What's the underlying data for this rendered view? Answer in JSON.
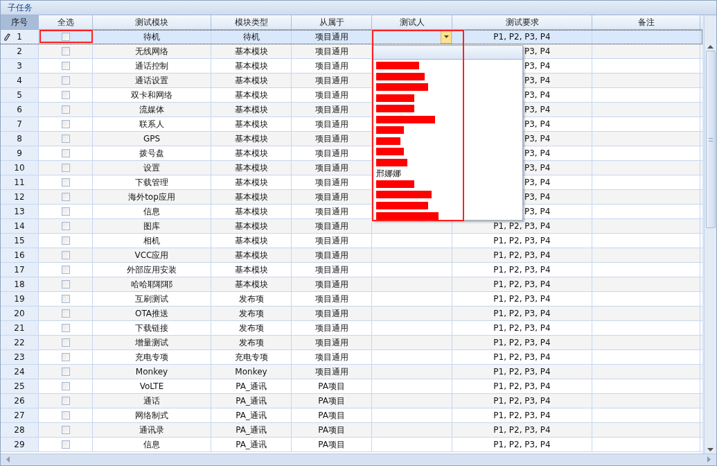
{
  "panel": {
    "title": "子任务"
  },
  "table": {
    "columns": [
      "序号",
      "全选",
      "测试模块",
      "模块类型",
      "从属于",
      "测试人",
      "测试要求",
      "备注"
    ],
    "rows": [
      {
        "num": "1",
        "checked": false,
        "selected": true,
        "module": "待机",
        "type": "待机",
        "belongs": "项目通用",
        "requirement": "P1, P2, P3, P4",
        "requirement_clipped": false
      },
      {
        "num": "2",
        "checked": false,
        "selected": false,
        "module": "无线网络",
        "type": "基本模块",
        "belongs": "项目通用",
        "requirement": "P3, P4",
        "requirement_clipped": true
      },
      {
        "num": "3",
        "checked": false,
        "selected": false,
        "module": "通话控制",
        "type": "基本模块",
        "belongs": "项目通用",
        "requirement": "P3, P4",
        "requirement_clipped": true
      },
      {
        "num": "4",
        "checked": false,
        "selected": false,
        "module": "通话设置",
        "type": "基本模块",
        "belongs": "项目通用",
        "requirement": "P3, P4",
        "requirement_clipped": true
      },
      {
        "num": "5",
        "checked": false,
        "selected": false,
        "module": "双卡和网络",
        "type": "基本模块",
        "belongs": "项目通用",
        "requirement": "P3, P4",
        "requirement_clipped": true
      },
      {
        "num": "6",
        "checked": false,
        "selected": false,
        "module": "流媒体",
        "type": "基本模块",
        "belongs": "项目通用",
        "requirement": "P3, P4",
        "requirement_clipped": true
      },
      {
        "num": "7",
        "checked": false,
        "selected": false,
        "module": "联系人",
        "type": "基本模块",
        "belongs": "项目通用",
        "requirement": "P3, P4",
        "requirement_clipped": true
      },
      {
        "num": "8",
        "checked": false,
        "selected": false,
        "module": "GPS",
        "type": "基本模块",
        "belongs": "项目通用",
        "requirement": "P3, P4",
        "requirement_clipped": true
      },
      {
        "num": "9",
        "checked": false,
        "selected": false,
        "module": "拨号盘",
        "type": "基本模块",
        "belongs": "项目通用",
        "requirement": "P3, P4",
        "requirement_clipped": true
      },
      {
        "num": "10",
        "checked": false,
        "selected": false,
        "module": "设置",
        "type": "基本模块",
        "belongs": "项目通用",
        "requirement": "P3, P4",
        "requirement_clipped": true
      },
      {
        "num": "11",
        "checked": false,
        "selected": false,
        "module": "下载管理",
        "type": "基本模块",
        "belongs": "项目通用",
        "requirement": "P3, P4",
        "requirement_clipped": true
      },
      {
        "num": "12",
        "checked": false,
        "selected": false,
        "module": "海外top应用",
        "type": "基本模块",
        "belongs": "项目通用",
        "requirement": "P3, P4",
        "requirement_clipped": true
      },
      {
        "num": "13",
        "checked": false,
        "selected": false,
        "module": "信息",
        "type": "基本模块",
        "belongs": "项目通用",
        "requirement": "P3, P4",
        "requirement_clipped": true
      },
      {
        "num": "14",
        "checked": false,
        "selected": false,
        "module": "图库",
        "type": "基本模块",
        "belongs": "项目通用",
        "requirement": "P1, P2, P3, P4",
        "requirement_clipped": false
      },
      {
        "num": "15",
        "checked": false,
        "selected": false,
        "module": "相机",
        "type": "基本模块",
        "belongs": "项目通用",
        "requirement": "P1, P2, P3, P4",
        "requirement_clipped": false
      },
      {
        "num": "16",
        "checked": false,
        "selected": false,
        "module": "VCC应用",
        "type": "基本模块",
        "belongs": "项目通用",
        "requirement": "P1, P2, P3, P4",
        "requirement_clipped": false
      },
      {
        "num": "17",
        "checked": false,
        "selected": false,
        "module": "外部应用安装",
        "type": "基本模块",
        "belongs": "项目通用",
        "requirement": "P1, P2, P3, P4",
        "requirement_clipped": false
      },
      {
        "num": "18",
        "checked": false,
        "selected": false,
        "module": "哈哈耶耶耶",
        "type": "基本模块",
        "belongs": "项目通用",
        "requirement": "P1, P2, P3, P4",
        "requirement_clipped": false
      },
      {
        "num": "19",
        "checked": false,
        "selected": false,
        "module": "互刷测试",
        "type": "发布项",
        "belongs": "项目通用",
        "requirement": "P1, P2, P3, P4",
        "requirement_clipped": false
      },
      {
        "num": "20",
        "checked": false,
        "selected": false,
        "module": "OTA推送",
        "type": "发布项",
        "belongs": "项目通用",
        "requirement": "P1, P2, P3, P4",
        "requirement_clipped": false
      },
      {
        "num": "21",
        "checked": false,
        "selected": false,
        "module": "下载链接",
        "type": "发布项",
        "belongs": "项目通用",
        "requirement": "P1, P2, P3, P4",
        "requirement_clipped": false
      },
      {
        "num": "22",
        "checked": false,
        "selected": false,
        "module": "增量测试",
        "type": "发布项",
        "belongs": "项目通用",
        "requirement": "P1, P2, P3, P4",
        "requirement_clipped": false
      },
      {
        "num": "23",
        "checked": false,
        "selected": false,
        "module": "充电专项",
        "type": "充电专项",
        "belongs": "项目通用",
        "requirement": "P1, P2, P3, P4",
        "requirement_clipped": false
      },
      {
        "num": "24",
        "checked": false,
        "selected": false,
        "module": "Monkey",
        "type": "Monkey",
        "belongs": "项目通用",
        "requirement": "P1, P2, P3, P4",
        "requirement_clipped": false
      },
      {
        "num": "25",
        "checked": false,
        "selected": false,
        "module": "VoLTE",
        "type": "PA_通讯",
        "belongs": "PA项目",
        "requirement": "P1, P2, P3, P4",
        "requirement_clipped": false
      },
      {
        "num": "26",
        "checked": false,
        "selected": false,
        "module": "通话",
        "type": "PA_通讯",
        "belongs": "PA项目",
        "requirement": "P1, P2, P3, P4",
        "requirement_clipped": false
      },
      {
        "num": "27",
        "checked": false,
        "selected": false,
        "module": "网络制式",
        "type": "PA_通讯",
        "belongs": "PA项目",
        "requirement": "P1, P2, P3, P4",
        "requirement_clipped": false
      },
      {
        "num": "28",
        "checked": false,
        "selected": false,
        "module": "通讯录",
        "type": "PA_通讯",
        "belongs": "PA项目",
        "requirement": "P1, P2, P3, P4",
        "requirement_clipped": false
      },
      {
        "num": "29",
        "checked": false,
        "selected": false,
        "module": "信息",
        "type": "PA_通讯",
        "belongs": "PA项目",
        "requirement": "P1, P2, P3, P4",
        "requirement_clipped": false
      }
    ]
  },
  "tester_dropdown": {
    "items": [
      {
        "redacted": true
      },
      {
        "redacted": true
      },
      {
        "redacted": true
      },
      {
        "redacted": true
      },
      {
        "redacted": true
      },
      {
        "redacted": true
      },
      {
        "redacted": true
      },
      {
        "redacted": true
      },
      {
        "redacted": true
      },
      {
        "redacted": true
      },
      {
        "redacted": false,
        "text": "邢娜娜"
      },
      {
        "redacted": true
      },
      {
        "redacted": true
      },
      {
        "redacted": true
      },
      {
        "redacted": true
      }
    ]
  }
}
